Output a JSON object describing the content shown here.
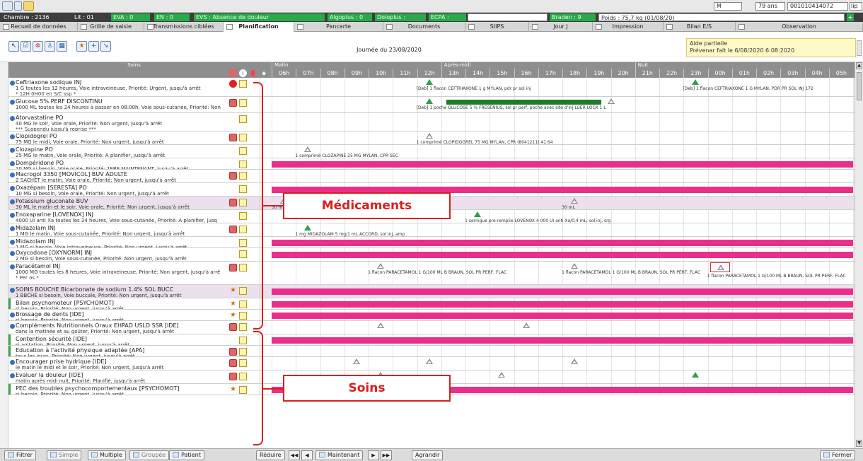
{
  "topbar": {
    "sex": "M",
    "age": "79 ans",
    "ipp": "001010414072",
    "ipp_suffix": "lip"
  },
  "patient_bar": {
    "room": "Chambre : 2136",
    "bed": "Lit : 01",
    "eva": "EVA : 0",
    "en": "EN : 0",
    "evs": "EVS : Absence de douleur",
    "algoplus": "Algoplus : 0",
    "doloplus": "Doloplus :",
    "ecpa": "ECPA :",
    "braden": "Braden : 9",
    "weight": "Poids : 75,7 kg  (01/08/20)"
  },
  "tabs": [
    {
      "label": "Recueil de données"
    },
    {
      "label": "Grille de saisie"
    },
    {
      "label": "Transmissions ciblées"
    },
    {
      "label": "Planification",
      "active": true
    },
    {
      "label": "Pancarte"
    },
    {
      "label": "Documents"
    },
    {
      "label": "SIIPS"
    },
    {
      "label": "Jour J"
    },
    {
      "label": "Impression"
    },
    {
      "label": "Bilan E/S"
    },
    {
      "label": "Observation"
    }
  ],
  "toolbar": {
    "date_label": "Journée du 23/08/2020",
    "help_title": "Aide partielle",
    "help_detail": "Prévenar fait le 6/08/2020 6:08:2020"
  },
  "timeline": {
    "periods": [
      "Matin",
      "Après-midi",
      "Nuit"
    ],
    "column_title": "Soins",
    "hours": [
      "06h",
      "07h",
      "08h",
      "09h",
      "10h",
      "11h",
      "12h",
      "13h",
      "14h",
      "15h",
      "16h",
      "17h",
      "18h",
      "19h",
      "20h",
      "21h",
      "22h",
      "23h",
      "00h",
      "01h",
      "02h",
      "03h",
      "04h",
      "05h"
    ]
  },
  "colors": {
    "band": "#ea2f8a",
    "done": "#2fa04a",
    "planned": "#8a8a8a",
    "annotation": "#d81f1f"
  },
  "mark_kinds": {
    "band": "pink bar = si besoin (as needed)",
    "done": "green triangle = administered",
    "plan": "grey triangle = planned",
    "bar": "dark green bar = infusion in progress",
    "redbox": "red frame = current dose"
  },
  "rows": [
    {
      "drug": "Ceftriaxone sodique INJ",
      "detail": "1 G toutes les 12 heures, Voie intraveineuse, Priorité: Urgent, jusqu'à arrêt",
      "note": "* 12H 0H00 en S/C ssp *",
      "icon": "stop",
      "marks": [
        {
          "kind": "done",
          "h": 6.5,
          "label": "[Deb] 1 flacon CEFTRIAXONE 1 g MYLAN, pdr pr sol inj"
        },
        {
          "kind": "done",
          "h": 17.5,
          "label": "[Deb] 1 flacon CEFTRIAXONE 1 G MYLAN, PDR PR SOL INJ 172"
        }
      ]
    },
    {
      "drug": "Glucose 5% PERF DISCONTINU",
      "detail": "1000 ML toutes les 24 heures à passer en 08:00h, Voie sous-cutanée, Priorité: Non",
      "note": "",
      "icon": "red",
      "marks": [
        {
          "kind": "done",
          "h": 6.5,
          "label": "[Deb] 1 poche GLUCOSE 5 % FRESENIUS, sol pr perf, poche avec site d'inj LUER LOCK 1 L"
        },
        {
          "kind": "bar",
          "h": 7.2,
          "h2": 13.6,
          "label": ""
        },
        {
          "kind": "plan",
          "h": 14.0,
          "label": ""
        }
      ]
    },
    {
      "drug": "Atorvastatine PO",
      "detail": "40 MG le soir, Voie orale, Priorité: Non urgent, jusqu'à arrêt",
      "note": "*** Suspendu jusqu'à reprise ***",
      "icon": "none",
      "marks": []
    },
    {
      "drug": "Clopidogrel PO",
      "detail": "75 MG le midi, Voie orale, Priorité: Non urgent, jusqu'à arrêt",
      "note": "",
      "icon": "red",
      "marks": [
        {
          "kind": "plan",
          "h": 6.5,
          "label": "1 comprimé CLOPIDOGREL 75 MG MYLAN, CPR (8041211) 41 64"
        }
      ]
    },
    {
      "drug": "Clozapine PO",
      "detail": "25 MG le matin, Voie orale, Priorité: A planifier, jusqu'à arrêt",
      "note": "",
      "icon": "none",
      "marks": [
        {
          "kind": "plan",
          "h": 1.5,
          "label": "1 comprimé CLOZAPINE 25 MG MYLAN, CPR SEC"
        }
      ]
    },
    {
      "drug": "Dompéridone PO",
      "detail": "10 MG si besoin, Voie orale, Priorité: 1ERE MAINTENANT, jusqu'à arrêt",
      "note": "",
      "icon": "none",
      "marks": [
        {
          "kind": "band",
          "h": 0,
          "label": ""
        }
      ]
    },
    {
      "drug": "Macrogol 3350 [MOVICOL] BUV ADULTE",
      "detail": "2 SACHET le matin, Voie orale, Priorité: Non urgent, jusqu'à arrêt",
      "note": "",
      "icon": "red",
      "marks": []
    },
    {
      "drug": "Oxazépam [SERESTA] PO",
      "detail": "10 MG si besoin, Voie orale, Priorité: Non urgent, jusqu'à arrêt",
      "note": "",
      "icon": "none",
      "marks": [
        {
          "kind": "band",
          "h": 0,
          "label": ""
        }
      ]
    },
    {
      "drug": "Potassium gluconate BUV",
      "detail": "30 ML le matin et le soir, Voie orale, Priorité: Non urgent, jusqu'à arrêt",
      "note": "",
      "icon": "red",
      "alt": true,
      "marks": [
        {
          "kind": "plan",
          "h": 0.5,
          "label": "30 mL"
        },
        {
          "kind": "plan",
          "h": 12.5,
          "label": "30 mL"
        }
      ]
    },
    {
      "drug": "Enoxaparine [LOVENOX] INJ",
      "detail": "4000 UI anti Xa toutes les 24 heures, Voie sous-cutanée, Priorité: A planifier, jusq",
      "note": "",
      "icon": "none",
      "marks": [
        {
          "kind": "done",
          "h": 8.5,
          "label": "1 seringue pré-remplie LOVENOX 4 000 UI anti-Xa/0,4 mL, sol inj, srg"
        }
      ]
    },
    {
      "drug": "Midazolam INJ",
      "detail": "1 MG le matin, Voie sous-cutanée, Priorité: Non urgent, jusqu'à arrêt",
      "note": "",
      "icon": "red",
      "marks": [
        {
          "kind": "done",
          "h": 1.5,
          "label": "1 mg MIDAZOLAM 5 mg/1 mL ACCORD, sol inj, amp"
        }
      ]
    },
    {
      "drug": "Midazolam INJ",
      "detail": "1 MG si besoin, Voie intraveineuse, Priorité: Non urgent, jusqu'à arrêt",
      "note": "",
      "icon": "none",
      "marks": [
        {
          "kind": "band",
          "h": 0,
          "label": ""
        }
      ]
    },
    {
      "drug": "Oxycodone [OXYNORM] INJ",
      "detail": "2 MG si besoin, Voie sous-cutanée, Priorité: Non urgent, jusqu'à arrêt",
      "note": "",
      "icon": "none",
      "marks": [
        {
          "kind": "band",
          "h": 0,
          "label": ""
        }
      ]
    },
    {
      "drug": "Paracétamol INJ",
      "detail": "1000 MG toutes les 8 heures, Voie intraveineuse, Priorité: Non urgent, jusqu'à arrê",
      "note": "* Per os *",
      "icon": "red",
      "marks": [
        {
          "kind": "plan",
          "h": 4.5,
          "label": "1 flacon PARACETAMOL 1 G/100 ML B BRAUN, SOL PR PERF, FLAC"
        },
        {
          "kind": "plan",
          "h": 12.5,
          "label": "1 flacon PARACETAMOL 1 G/100 ML B BRAUN, SOL PR PERF, FLAC"
        },
        {
          "kind": "redbox",
          "h": 18.5,
          "label": "1 flacon PARACETAMOL 1 G/100 ML B BRAUN, SOL PR PERF, FLAC"
        }
      ]
    },
    {
      "drug": "SOINS BOUCHE Bicarbonate de sodium 1.4% SOL BUCC",
      "detail": "1 BBCHE si besoin, Voie buccale, Priorité: Non urgent, jusqu'à arrêt",
      "note": "",
      "icon": "star",
      "alt": true,
      "marks": [
        {
          "kind": "band",
          "h": 0,
          "label": ""
        }
      ]
    },
    {
      "drug": "Bilan psychomoteur [PSYCHOMOT]",
      "detail": "si besoin, Priorité: Non urgent, jusqu'à arrêt",
      "note": "",
      "icon": "star",
      "care": true,
      "marks": [
        {
          "kind": "band",
          "h": 0,
          "label": ""
        }
      ]
    },
    {
      "drug": "Brossage de dents [IDE]",
      "detail": "si besoin, Priorité: Non urgent, jusqu'à arrêt",
      "note": "",
      "icon": "star",
      "marks": [
        {
          "kind": "band",
          "h": 0,
          "label": ""
        }
      ]
    },
    {
      "drug": "Compléments Nutritionnels Oraux EHPAD USLD SSR [IDE]",
      "detail": "dans la matinée et au goûter, Priorité: Non urgent, jusqu'à arrêt",
      "note": "",
      "icon": "red",
      "marks": [
        {
          "kind": "plan",
          "h": 4.5,
          "label": ""
        },
        {
          "kind": "plan",
          "h": 10.5,
          "label": ""
        }
      ]
    },
    {
      "drug": "Contention sécurité [IDE]",
      "detail": "si agitation, Priorité: Non urgent, jusqu'à arrêt",
      "note": "",
      "icon": "none",
      "care": true,
      "marks": [
        {
          "kind": "band",
          "h": 0,
          "label": ""
        }
      ]
    },
    {
      "drug": "Education à l'activité physique adaptée [APA]",
      "detail": "tous les jours, Priorité: Non urgent, jusqu'à arrêt",
      "note": "",
      "icon": "red",
      "care": true,
      "marks": []
    },
    {
      "drug": "Encourager prise hydrique [IDE]",
      "detail": "le matin le midi et le soir, Priorité: Non urgent, jusqu'à arrêt",
      "note": "",
      "icon": "red",
      "marks": [
        {
          "kind": "plan",
          "h": 3.5,
          "label": ""
        },
        {
          "kind": "plan",
          "h": 6.5,
          "label": ""
        },
        {
          "kind": "plan",
          "h": 12.5,
          "label": ""
        }
      ]
    },
    {
      "drug": "Evaluer la douleur [IDE]",
      "detail": "matin après midi nuit, Priorité: Planifié, jusqu'à arrêt",
      "note": "",
      "icon": "red",
      "marks": [
        {
          "kind": "plan",
          "h": 4.5,
          "label": ""
        },
        {
          "kind": "plan",
          "h": 9.5,
          "label": ""
        },
        {
          "kind": "done",
          "h": 17.5,
          "label": ""
        }
      ]
    },
    {
      "drug": "PEC des troubles psychocomportementaux [PSYCHOMOT]",
      "detail": "si besoin, Priorité: Non urgent, jusqu'à arrêt",
      "note": "",
      "icon": "star",
      "care": true,
      "marks": [
        {
          "kind": "band",
          "h": 0,
          "label": ""
        }
      ]
    }
  ],
  "annotations": {
    "medicaments": "Médicaments",
    "soins": "Soins"
  },
  "bottom": {
    "filter": "Filtrer",
    "simple": "Simple",
    "multiple": "Multiple",
    "grouped": "Groupée",
    "patient": "Patient",
    "reduce": "Réduire",
    "now": "Maintenant",
    "enlarge": "Agrandir",
    "close": "Fermer"
  }
}
